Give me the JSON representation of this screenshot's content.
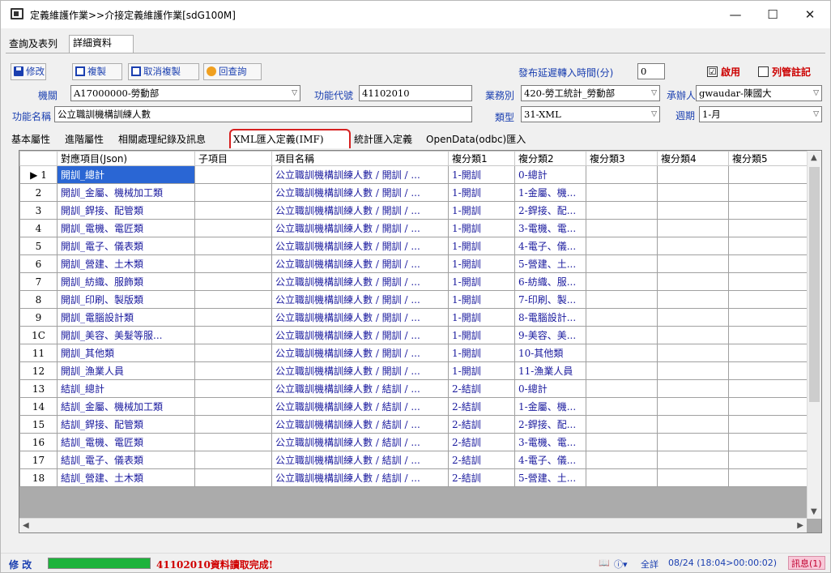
{
  "window": {
    "title": "定義維護作業>>介接定義維護作業[sdG100M]",
    "min": "—",
    "max": "☐",
    "close": "✕"
  },
  "outer_tabs": [
    "查詢及表列",
    "詳細資料"
  ],
  "toolbar": {
    "modify": "修改",
    "copy": "複製",
    "cancel_copy": "取消複製",
    "back_query": "回查詢",
    "delay_label": "發布延遲轉入時間(分)",
    "delay_value": "0",
    "enabled_label": "啟用",
    "enabled_checked": "☑",
    "annot_label": "列管註記"
  },
  "form": {
    "agency_label": "機關",
    "agency_value": "A17000000-勞動部",
    "func_code_label": "功能代號",
    "func_code_value": "41102010",
    "business_label": "業務別",
    "business_value": "420-勞工統計_勞動部",
    "handler_label": "承辦人",
    "handler_value": "gwaudar-陳國大",
    "func_name_label": "功能名稱",
    "func_name_value": "公立職訓機構訓練人數",
    "type_label": "類型",
    "type_value": "31-XML",
    "period_label": "週期",
    "period_value": "1-月"
  },
  "inner_tabs": [
    "基本屬性",
    "進階屬性",
    "相關處理紀錄及訊息",
    "XML匯入定義(IMF)",
    "統計匯入定義",
    "OpenData(odbc)匯入"
  ],
  "grid": {
    "columns": [
      "對應項目(Json)",
      "子項目",
      "項目名稱",
      "複分類1",
      "複分類2",
      "複分類3",
      "複分類4",
      "複分類5"
    ],
    "row_numbers": [
      "1",
      "2",
      "3",
      "4",
      "5",
      "6",
      "7",
      "8",
      "9",
      "1C",
      "11",
      "12",
      "13",
      "14",
      "15",
      "16",
      "17",
      "18"
    ],
    "current_row_marker": "▶",
    "rows": [
      [
        "開訓_總計",
        "",
        "公立職訓機構訓練人數 / 開訓 / ...",
        "1-開訓",
        "0-總計"
      ],
      [
        "開訓_金屬、機械加工類",
        "",
        "公立職訓機構訓練人數 / 開訓 / ...",
        "1-開訓",
        "1-金屬、機..."
      ],
      [
        "開訓_銲接、配管類",
        "",
        "公立職訓機構訓練人數 / 開訓 / ...",
        "1-開訓",
        "2-銲接、配..."
      ],
      [
        "開訓_電機、電匠類",
        "",
        "公立職訓機構訓練人數 / 開訓 / ...",
        "1-開訓",
        "3-電機、電..."
      ],
      [
        "開訓_電子、儀表類",
        "",
        "公立職訓機構訓練人數 / 開訓 / ...",
        "1-開訓",
        "4-電子、儀..."
      ],
      [
        "開訓_營建、土木類",
        "",
        "公立職訓機構訓練人數 / 開訓 / ...",
        "1-開訓",
        "5-營建、土..."
      ],
      [
        "開訓_紡織、服飾類",
        "",
        "公立職訓機構訓練人數 / 開訓 / ...",
        "1-開訓",
        "6-紡織、服..."
      ],
      [
        "開訓_印刷、製版類",
        "",
        "公立職訓機構訓練人數 / 開訓 / ...",
        "1-開訓",
        "7-印刷、製..."
      ],
      [
        "開訓_電腦設計類",
        "",
        "公立職訓機構訓練人數 / 開訓 / ...",
        "1-開訓",
        "8-電腦設計..."
      ],
      [
        "開訓_美容、美髮等服...",
        "",
        "公立職訓機構訓練人數 / 開訓 / ...",
        "1-開訓",
        "9-美容、美..."
      ],
      [
        "開訓_其他類",
        "",
        "公立職訓機構訓練人數 / 開訓 / ...",
        "1-開訓",
        "10-其他類"
      ],
      [
        "開訓_漁業人員",
        "",
        "公立職訓機構訓練人數 / 開訓 / ...",
        "1-開訓",
        "11-漁業人員"
      ],
      [
        "結訓_總計",
        "",
        "公立職訓機構訓練人數 / 結訓 / ...",
        "2-結訓",
        "0-總計"
      ],
      [
        "結訓_金屬、機械加工類",
        "",
        "公立職訓機構訓練人數 / 結訓 / ...",
        "2-結訓",
        "1-金屬、機..."
      ],
      [
        "結訓_銲接、配管類",
        "",
        "公立職訓機構訓練人數 / 結訓 / ...",
        "2-結訓",
        "2-銲接、配..."
      ],
      [
        "結訓_電機、電匠類",
        "",
        "公立職訓機構訓練人數 / 結訓 / ...",
        "2-結訓",
        "3-電機、電..."
      ],
      [
        "結訓_電子、儀表類",
        "",
        "公立職訓機構訓練人數 / 結訓 / ...",
        "2-結訓",
        "4-電子、儀..."
      ],
      [
        "結訓_營建、土木類",
        "",
        "公立職訓機構訓練人數 / 結訓 / ...",
        "2-結訓",
        "5-營建、土..."
      ]
    ]
  },
  "status": {
    "mode": "修 改",
    "progress": 1.0,
    "message": "41102010資料讀取完成!",
    "full_label": "全詳",
    "time_info": "08/24 (18:04>00:00:02)",
    "msg_button": "訊息(1)"
  },
  "colors": {
    "accent_blue": "#1a3fb0",
    "selected_cell": "#2a66d4",
    "progress_green": "#1db33c",
    "highlight_red": "#d62020",
    "status_red": "#d00000"
  },
  "icons": [
    "app-icon",
    "save-icon",
    "copy-icon",
    "cancel-copy-icon",
    "back-query-icon",
    "book-icon",
    "help-icon"
  ]
}
